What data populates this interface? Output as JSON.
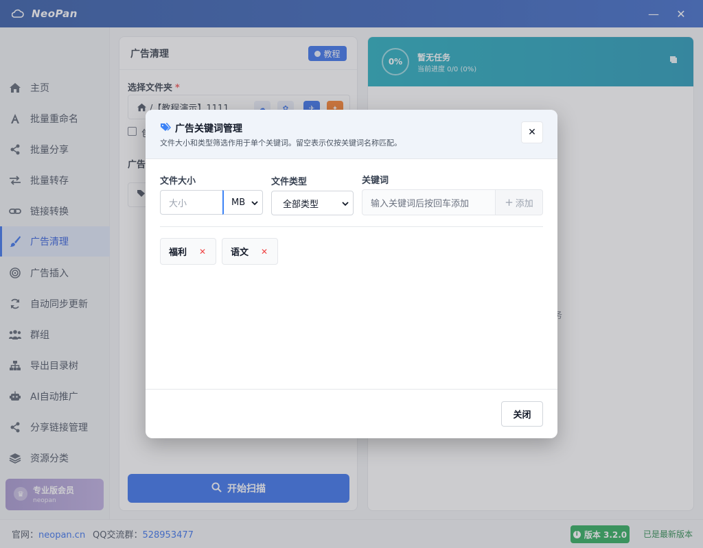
{
  "app": {
    "name": "NeoPan",
    "min_glyph": "—",
    "close_glyph": "✕"
  },
  "sidebar": {
    "items": [
      {
        "label": "主页",
        "icon": "home-icon"
      },
      {
        "label": "批量重命名",
        "icon": "font-icon"
      },
      {
        "label": "批量分享",
        "icon": "share-icon"
      },
      {
        "label": "批量转存",
        "icon": "transfer-icon"
      },
      {
        "label": "链接转换",
        "icon": "link-icon"
      },
      {
        "label": "广告清理",
        "icon": "brush-icon",
        "active": true
      },
      {
        "label": "广告插入",
        "icon": "target-icon"
      },
      {
        "label": "自动同步更新",
        "icon": "sync-icon"
      },
      {
        "label": "群组",
        "icon": "users-icon"
      },
      {
        "label": "导出目录树",
        "icon": "sitemap-icon"
      },
      {
        "label": "AI自动推广",
        "icon": "robot-icon"
      },
      {
        "label": "分享链接管理",
        "icon": "share-icon"
      },
      {
        "label": "资源分类",
        "icon": "layers-icon"
      }
    ],
    "pro": {
      "title": "专业版会员",
      "subtitle": "neopan"
    }
  },
  "main": {
    "title": "广告清理",
    "tutorial_label": "教程",
    "folder_label": "选择文件夹",
    "required_mark": "*",
    "folder_path": "/【教程演示】1111",
    "checkbox_label": "包",
    "ad_label": "广告",
    "scan_label": "开始扫描"
  },
  "task": {
    "percent": "0%",
    "title": "暂无任务",
    "progress": "当前进度 0/0 (0%)",
    "hint": "务"
  },
  "footer": {
    "site_label": "官网：",
    "site": "neopan.cn",
    "qq_label": "QQ交流群：",
    "qq": "528953477",
    "version": "版本 3.2.0",
    "version_status": "已是最新版本"
  },
  "modal": {
    "title": "广告关键词管理",
    "subtitle": "文件大小和类型筛选作用于单个关键词。留空表示仅按关键词名称匹配。",
    "size_label": "文件大小",
    "size_placeholder": "大小",
    "unit_value": "MB",
    "type_label": "文件类型",
    "type_value": "全部类型",
    "keyword_label": "关键词",
    "keyword_placeholder": "输入关键词后按回车添加",
    "add_label": "添加",
    "keywords": [
      "福利",
      "语文"
    ],
    "close_label": "关闭"
  },
  "colors": {
    "accent": "#2563eb",
    "success": "#16a34a",
    "danger": "#ef4444",
    "teal": "#0ea5b7"
  }
}
